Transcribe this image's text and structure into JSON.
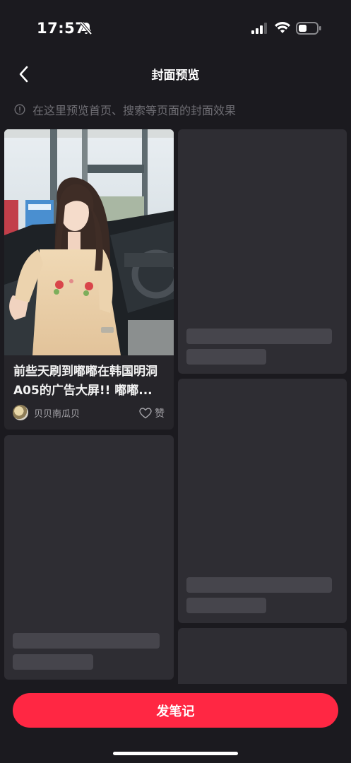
{
  "status": {
    "time": "17:57"
  },
  "nav": {
    "title": "封面预览"
  },
  "hint": {
    "text": "在这里预览首页、搜索等页面的封面效果"
  },
  "note": {
    "title": "前些天刷到嘟嘟在韩国明洞A05的广告大屏!! 嘟嘟...",
    "author": "贝贝南瓜贝",
    "like_label": "赞"
  },
  "actions": {
    "publish": "发笔记"
  },
  "colors": {
    "accent": "#ff2743",
    "background": "#1b1a1f",
    "skeleton": "#2e2d33",
    "hint": "#6f6e74"
  }
}
